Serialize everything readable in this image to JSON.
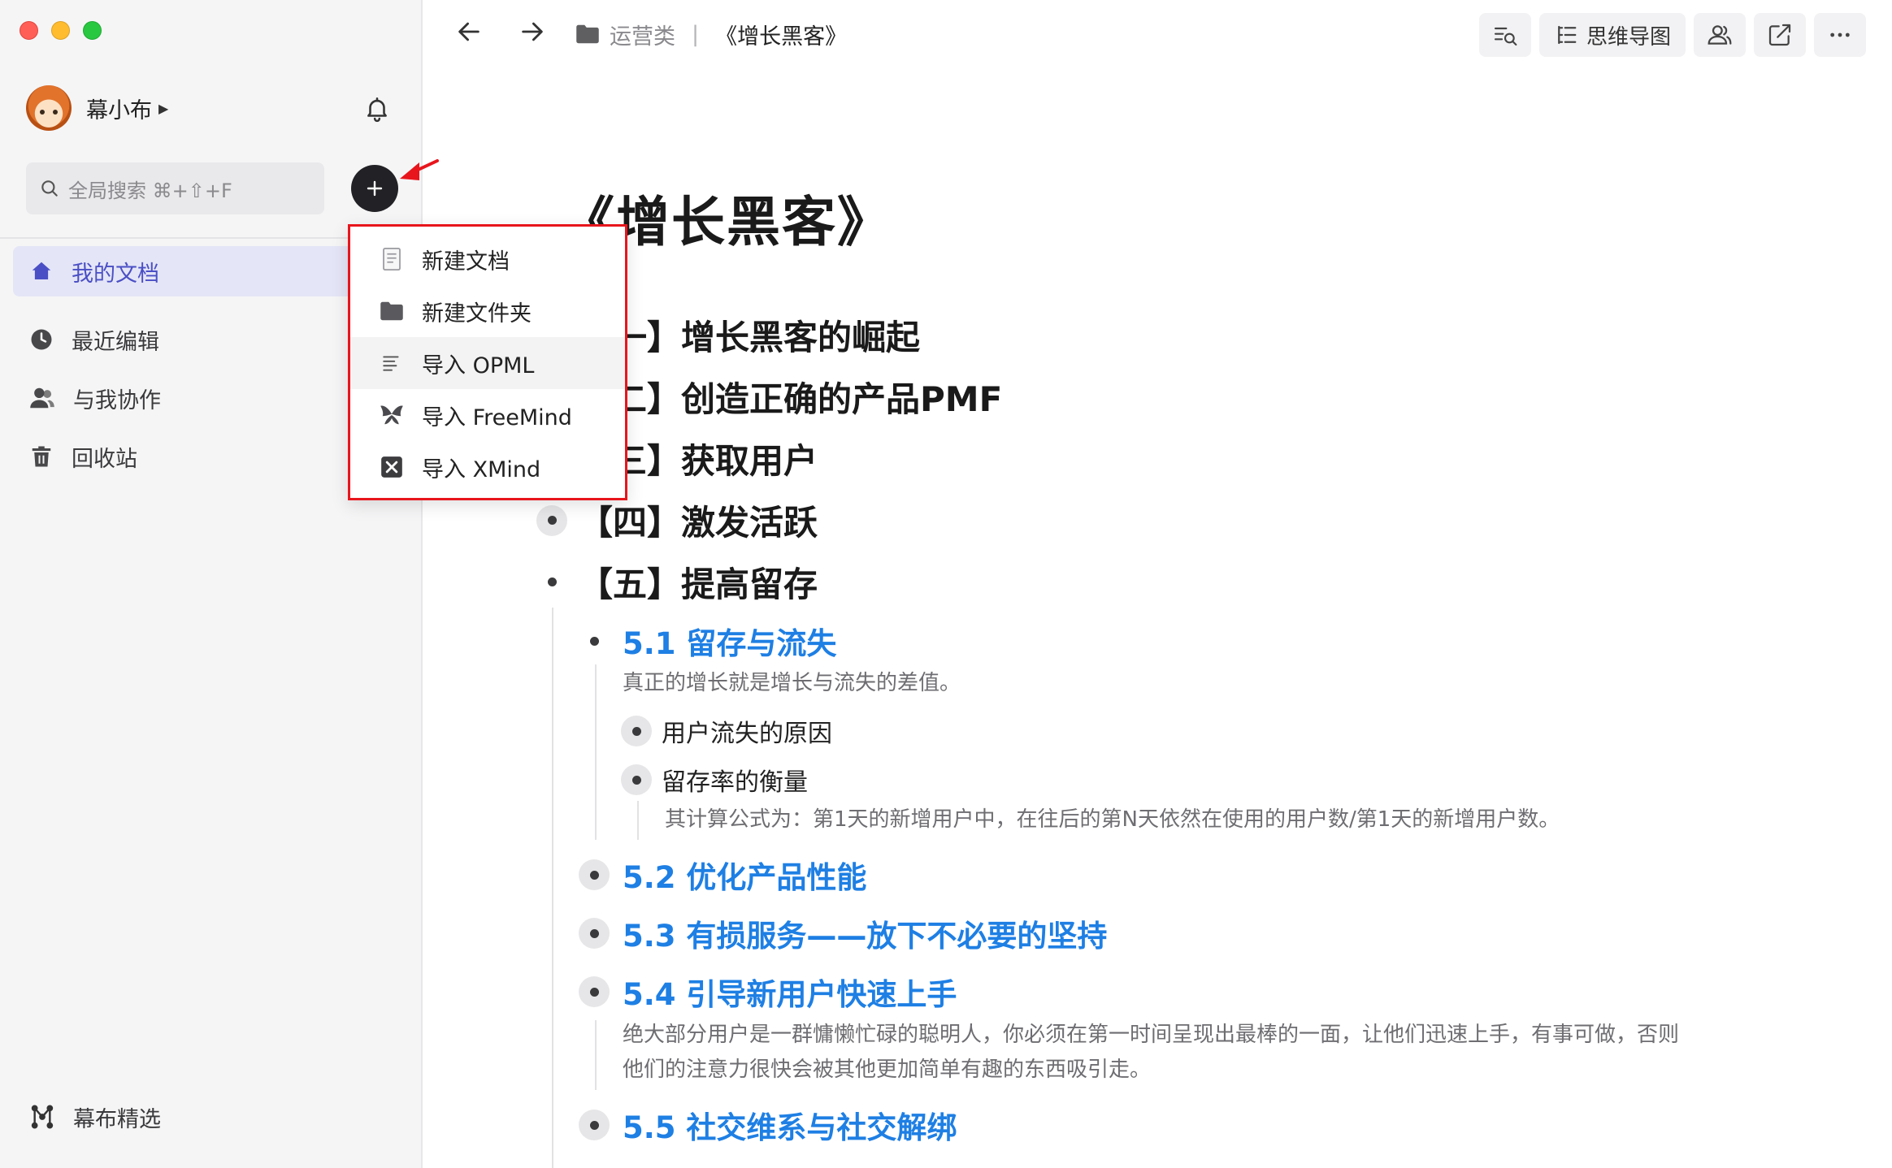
{
  "user": {
    "name": "幕小布"
  },
  "search": {
    "placeholder": "全局搜索 ⌘+⇧+F"
  },
  "nav": {
    "my_docs": "我的文档",
    "recent": "最近编辑",
    "shared": "与我协作",
    "trash": "回收站",
    "featured": "幕布精选"
  },
  "menu": {
    "items": [
      "新建文档",
      "新建文件夹",
      "导入 OPML",
      "导入 FreeMind",
      "导入 XMind"
    ]
  },
  "breadcrumb": {
    "folder": "运营类",
    "separator": "|",
    "doc": "《增长黑客》"
  },
  "toolbar": {
    "mindmap_label": "思维导图"
  },
  "doc": {
    "title": "《增长黑客》",
    "sections": [
      "【一】增长黑客的崛起",
      "【二】创造正确的产品PMF",
      "【三】获取用户",
      "【四】激发活跃",
      "【五】提高留存"
    ],
    "sub_5_1": "5.1 留存与流失",
    "note_5_1": "真正的增长就是增长与流失的差值。",
    "item_churn": "用户流失的原因",
    "item_retention": "留存率的衡量",
    "note_retention": "其计算公式为：第1天的新增用户中，在往后的第N天依然在使用的用户数/第1天的新增用户数。",
    "sub_5_2": "5.2 优化产品性能",
    "sub_5_3": "5.3 有损服务——放下不必要的坚持",
    "sub_5_4": "5.4 引导新用户快速上手",
    "note_5_4_line1": "绝大部分用户是一群慵懒忙碌的聪明人，你必须在第一时间呈现出最棒的一面，让他们迅速上手，有事可做，否则",
    "note_5_4_line2": "他们的注意力很快会被其他更加简单有趣的东西吸引走。",
    "sub_5_5": "5.5 社交维系与社交解绑"
  },
  "colors": {
    "accent_blue": "#1e7fe4",
    "active_nav": "#4a4fc5",
    "highlight_border": "#e8151c"
  }
}
